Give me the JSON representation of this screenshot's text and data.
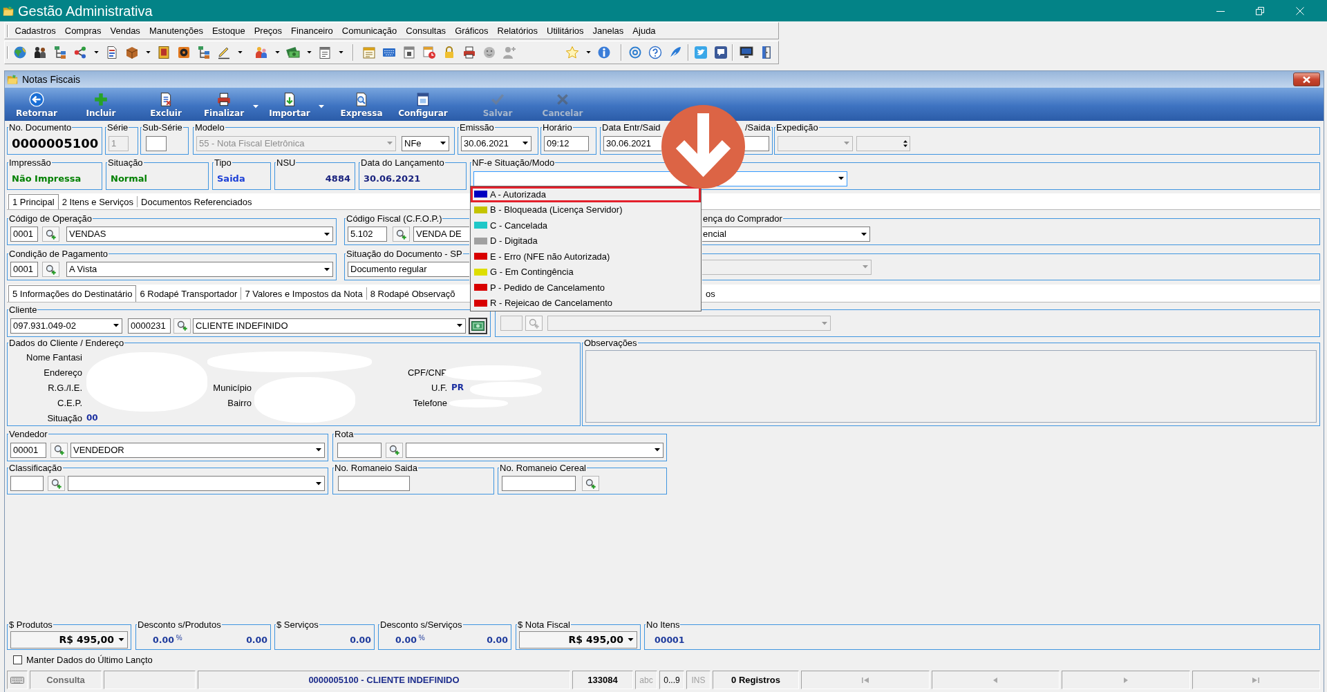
{
  "window": {
    "title": "Gestão Administrativa"
  },
  "menu": [
    "Cadastros",
    "Compras",
    "Vendas",
    "Manutenções",
    "Estoque",
    "Preços",
    "Financeiro",
    "Comunicação",
    "Consultas",
    "Gráficos",
    "Relatórios",
    "Utilitários",
    "Janelas",
    "Ajuda"
  ],
  "document_window": {
    "title": "Notas Fiscais"
  },
  "actions": [
    {
      "label": "Retornar",
      "disabled": false,
      "menu": false
    },
    {
      "label": "Incluir",
      "disabled": false,
      "menu": false
    },
    {
      "label": "Excluir",
      "disabled": false,
      "menu": false
    },
    {
      "label": "Finalizar",
      "disabled": false,
      "menu": true
    },
    {
      "label": "Importar",
      "disabled": false,
      "menu": true
    },
    {
      "label": "Expressa",
      "disabled": false,
      "menu": false
    },
    {
      "label": "Configurar",
      "disabled": false,
      "menu": false
    },
    {
      "label": "Salvar",
      "disabled": true,
      "menu": false
    },
    {
      "label": "Cancelar",
      "disabled": true,
      "menu": false
    }
  ],
  "document_header": [
    [
      {
        "label": "No. Documento",
        "fields": [
          {
            "kind": "number",
            "value": "0000005100"
          }
        ]
      },
      {
        "label": "Série",
        "fields": [
          {
            "kind": "text",
            "value": "1",
            "disabled": true
          }
        ]
      },
      {
        "label": "Sub-Série",
        "fields": [
          {
            "kind": "text",
            "disabled": false
          }
        ]
      },
      {
        "label": "Modelo",
        "fields": [
          {
            "kind": "combo",
            "value": "55 - Nota Fiscal Eletrônica",
            "disabled": true
          },
          {
            "kind": "combo",
            "value": "NFe",
            "disabled": false
          }
        ]
      },
      {
        "label": "Emissão",
        "fields": [
          {
            "kind": "combo",
            "value": "30.06.2021",
            "disabled": false
          }
        ]
      },
      {
        "label": "Horário",
        "fields": [
          {
            "kind": "text",
            "value": "09:12",
            "disabled": false
          }
        ]
      },
      {
        "label": "Data Entr/Said",
        "fields": [
          {
            "kind": "text",
            "value": "30.06.2021",
            "disabled": false
          }
        ]
      },
      {
        "label": "/Saida",
        "fields": [
          {
            "kind": "text",
            "disabled": false
          }
        ]
      },
      {
        "label": "Expedição",
        "fields": [
          {
            "kind": "combo",
            "disabled": true
          },
          {
            "kind": "spin",
            "disabled": true
          }
        ]
      }
    ],
    [
      {
        "label": "Impressão",
        "fields": [
          {
            "kind": "status",
            "value": "Não Impressa",
            "color": "#008000"
          }
        ]
      },
      {
        "label": "Situação",
        "fields": [
          {
            "kind": "status",
            "value": "Normal",
            "color": "#008000"
          }
        ]
      },
      {
        "label": "Tipo",
        "fields": [
          {
            "kind": "status",
            "value": "Saida",
            "color": "#1c3fd6"
          }
        ]
      },
      {
        "label": "NSU",
        "fields": [
          {
            "kind": "status",
            "value": "4884",
            "color": "#1a237e"
          }
        ]
      },
      {
        "label": "Data do Lançamento",
        "fields": [
          {
            "kind": "status",
            "value": "30.06.2021",
            "color": "#1a237e"
          }
        ]
      },
      {
        "label": "NF-e Situação/Modo",
        "fields": [
          {
            "kind": "combo",
            "disabled": false,
            "expanded": true,
            "options": [
              {
                "label": "A - Autorizada",
                "color": "#0000c0",
                "selected": false,
                "annotated": true
              },
              {
                "label": "B - Bloqueada (Licença Servidor)",
                "color": "#c4c400",
                "selected": false,
                "annotated": false
              },
              {
                "label": "C - Cancelada",
                "color": "#20c8c8",
                "selected": false,
                "annotated": false
              },
              {
                "label": "D - Digitada",
                "color": "#a0a0a0",
                "selected": false,
                "annotated": false
              },
              {
                "label": "E - Erro (NFE não Autorizada)",
                "color": "#d80000",
                "selected": false,
                "annotated": false
              },
              {
                "label": "G - Em Contingência",
                "color": "#dede00",
                "selected": false,
                "annotated": false
              },
              {
                "label": "P - Pedido de Cancelamento",
                "color": "#d80000",
                "selected": false,
                "annotated": false
              },
              {
                "label": "R - Rejeicao de Cancelamento",
                "color": "#d80000",
                "selected": false,
                "annotated": false
              }
            ]
          }
        ]
      }
    ]
  ],
  "main_tabs": [
    {
      "label": "1 Principal",
      "selected": true
    },
    {
      "label": "2 Itens e Serviços",
      "selected": false
    },
    {
      "label": "Documentos Referenciados",
      "selected": false
    }
  ],
  "principal_rows": [
    [
      {
        "label": "Código de Operação",
        "fields": [
          {
            "kind": "text",
            "value": "0001",
            "disabled": false
          },
          {
            "kind": "lookup",
            "disabled": false
          },
          {
            "kind": "combo",
            "value": "VENDAS",
            "disabled": false
          }
        ]
      },
      {
        "label": "Código Fiscal (C.F.O.P.)",
        "fields": [
          {
            "kind": "text",
            "value": "5.102",
            "disabled": false
          },
          {
            "kind": "lookup",
            "disabled": false
          },
          {
            "kind": "combo",
            "value": "VENDA DE",
            "disabled": false
          }
        ]
      },
      {
        "label": "ença do Comprador",
        "fields": [
          {
            "kind": "combo",
            "value": "encial",
            "disabled": false
          }
        ]
      }
    ],
    [
      {
        "label": "Condição de Pagamento",
        "fields": [
          {
            "kind": "text",
            "value": "0001",
            "disabled": false
          },
          {
            "kind": "lookup",
            "disabled": false
          },
          {
            "kind": "combo",
            "value": "A Vista",
            "disabled": false
          }
        ]
      },
      {
        "label": "Situação do Documento - SP",
        "fields": [
          {
            "kind": "combo",
            "value": "Documento regular",
            "disabled": false
          }
        ]
      },
      {
        "fields": [
          {
            "kind": "combo",
            "disabled": true
          }
        ]
      }
    ]
  ],
  "detail_tabs": [
    {
      "label": "5 Informações do Destinatário",
      "selected": true
    },
    {
      "label": "6 Rodapé Transportador",
      "selected": false
    },
    {
      "label": "7 Valores e Impostos da Nota",
      "selected": false
    },
    {
      "label": "8 Rodapé Observaçõ",
      "selected": false
    },
    {
      "label": "os",
      "selected": false
    }
  ],
  "recipient_rows": [
    [
      {
        "label": "Cliente",
        "fields": [
          {
            "kind": "combo",
            "value": "097.931.049-02",
            "disabled": false
          },
          {
            "kind": "text",
            "value": "0000231",
            "disabled": false
          },
          {
            "kind": "lookup",
            "disabled": false
          },
          {
            "kind": "combo",
            "value": "CLIENTE INDEFINIDO",
            "disabled": false
          },
          {
            "kind": "cash",
            "disabled": false
          }
        ]
      },
      {
        "fields": [
          {
            "kind": "text",
            "disabled": true
          },
          {
            "kind": "lookup",
            "disabled": true
          },
          {
            "kind": "combo",
            "disabled": true
          }
        ]
      }
    ],
    [
      {
        "label": "Dados do Cliente / Endereço",
        "fields": [
          {
            "kind": "details",
            "items": [
              {
                "label": "Nome Fantasi"
              },
              {
                "label": "Endereço"
              },
              {
                "label": "CPF/CNP"
              },
              {
                "label": "R.G./I.E."
              },
              {
                "label": "Município"
              },
              {
                "label": "U.F.",
                "value": "PR"
              },
              {
                "label": "C.E.P."
              },
              {
                "label": "Bairro"
              },
              {
                "label": "Telefone"
              },
              {
                "label": "Situação",
                "value": "00"
              }
            ]
          }
        ]
      },
      {
        "label": "Observações",
        "fields": [
          {
            "kind": "memo"
          }
        ]
      }
    ],
    [
      {
        "label": "Vendedor",
        "fields": [
          {
            "kind": "text",
            "value": "00001",
            "disabled": false
          },
          {
            "kind": "lookup",
            "disabled": false
          },
          {
            "kind": "combo",
            "value": "VENDEDOR",
            "disabled": false
          }
        ]
      },
      {
        "label": "Rota",
        "fields": [
          {
            "kind": "text",
            "disabled": false
          },
          {
            "kind": "lookup",
            "disabled": false
          },
          {
            "kind": "combo",
            "disabled": false
          }
        ]
      }
    ],
    [
      {
        "label": "Classificação",
        "fields": [
          {
            "kind": "text",
            "disabled": false
          },
          {
            "kind": "lookup",
            "disabled": false
          },
          {
            "kind": "combo",
            "disabled": false
          }
        ]
      },
      {
        "label": "No. Romaneio Saida",
        "fields": [
          {
            "kind": "text",
            "disabled": false
          }
        ]
      },
      {
        "label": "No. Romaneio Cereal",
        "fields": [
          {
            "kind": "text",
            "disabled": false
          },
          {
            "kind": "lookup",
            "disabled": false
          }
        ]
      }
    ]
  ],
  "totals": [
    {
      "label": "$ Produtos",
      "kind": "select",
      "value": "R$ 495,00"
    },
    {
      "label": "Desconto s/Produtos",
      "kind": "discount",
      "percent": "0.00",
      "unit": "%",
      "value": "0.00"
    },
    {
      "label": "$ Serviços",
      "kind": "amount",
      "value": "0.00"
    },
    {
      "label": "Desconto s/Serviços",
      "kind": "discount",
      "percent": "0.00",
      "unit": "%",
      "value": "0.00"
    },
    {
      "label": "$ Nota Fiscal",
      "kind": "select",
      "value": "R$ 495,00"
    },
    {
      "label": "No Itens",
      "kind": "count",
      "value": "00001"
    }
  ],
  "keep_data": {
    "label": "Manter Dados do Último Lançto",
    "checked": false
  },
  "status_bar": {
    "segments": [
      {
        "kind": "icon"
      },
      {
        "kind": "text",
        "value": "Consulta"
      },
      {
        "kind": "blank"
      },
      {
        "kind": "title",
        "value": "0000005100 - CLIENTE INDEFINIDO"
      },
      {
        "kind": "number",
        "value": "133084"
      },
      {
        "kind": "indicator",
        "value": "abc",
        "active": false
      },
      {
        "kind": "indicator",
        "value": "0...9",
        "active": true
      },
      {
        "kind": "indicator",
        "value": "INS",
        "active": false
      },
      {
        "kind": "count",
        "value": "0 Registros"
      }
    ],
    "navigator": [
      {
        "disabled": true
      },
      {
        "disabled": true
      },
      {
        "disabled": true
      },
      {
        "disabled": true
      }
    ]
  }
}
